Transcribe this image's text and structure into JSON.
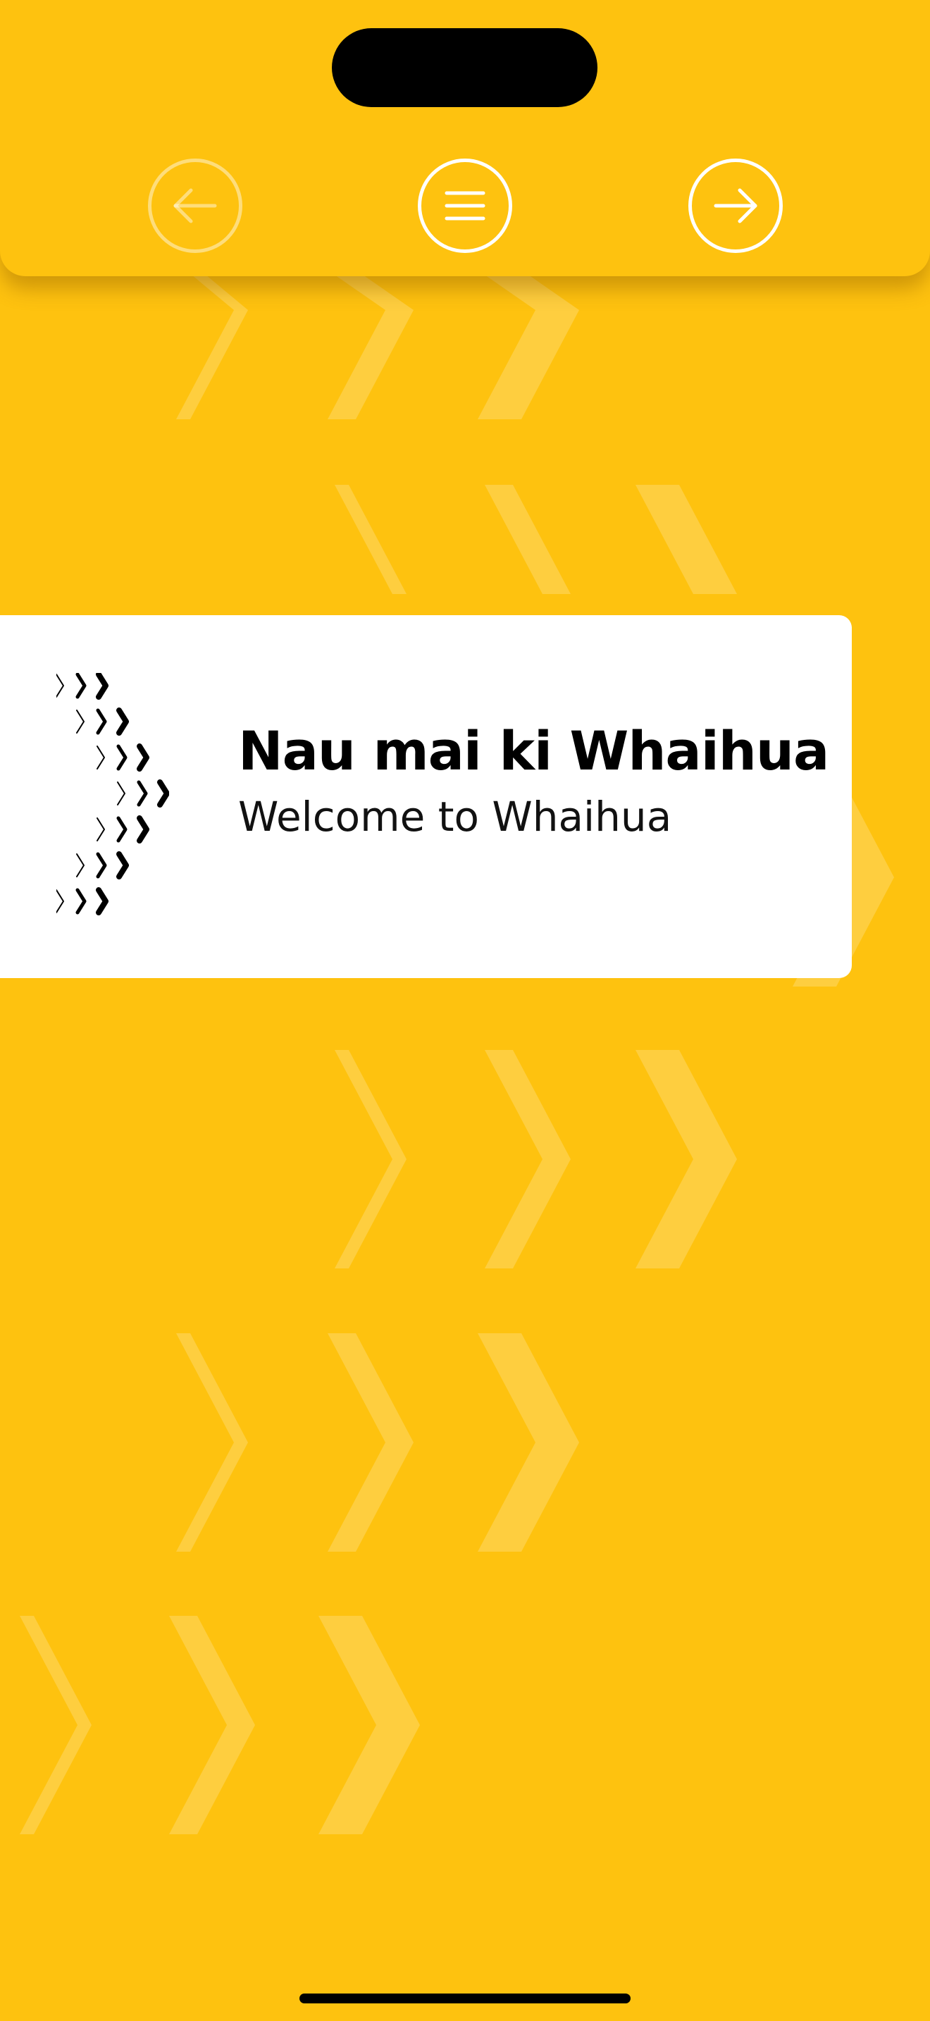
{
  "theme": {
    "background": "#FEC20F",
    "card": "#FFFFFF",
    "text": "#000000",
    "chevron_pattern": "#FFD459"
  },
  "nav": {
    "back": {
      "icon": "arrow-left-icon",
      "enabled": false
    },
    "menu": {
      "icon": "menu-icon",
      "enabled": true
    },
    "next": {
      "icon": "arrow-right-icon",
      "enabled": true
    }
  },
  "welcome": {
    "title": "Nau mai ki Whaihua",
    "subtitle": "Welcome to Whaihua",
    "logo_icon": "chevron-arrow-logo-icon"
  },
  "background_icon": "chevron-pattern-icon"
}
